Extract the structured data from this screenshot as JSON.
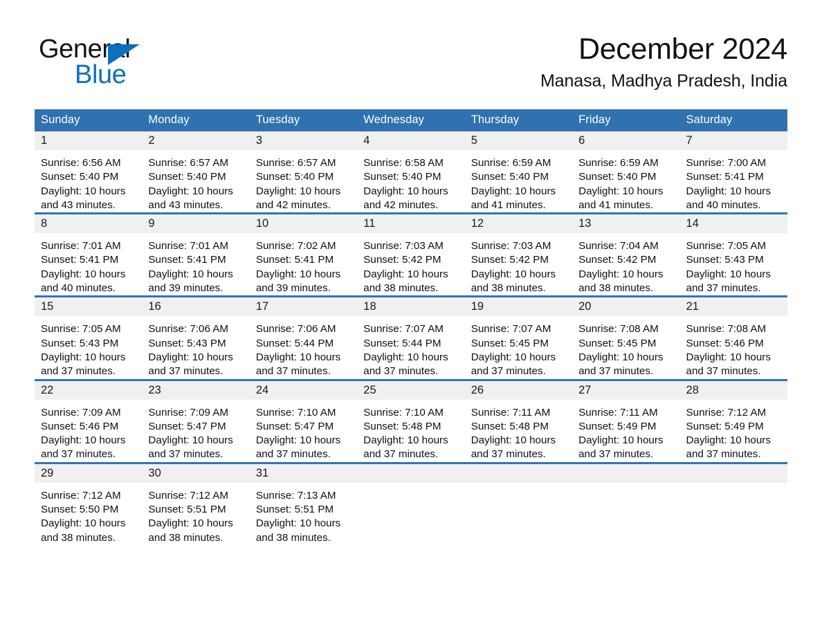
{
  "brand": {
    "name_part1": "General",
    "name_part2": "Blue",
    "triangle_icon": "triangle-icon",
    "accent_color": "#0E6FBC"
  },
  "header": {
    "title": "December 2024",
    "location": "Manasa, Madhya Pradesh, India"
  },
  "theme": {
    "header_blue": "#3071B0",
    "row_divider_blue": "#2E75B6",
    "daynum_band": "#F0F0F0"
  },
  "calendar": {
    "weekday_headers": [
      "Sunday",
      "Monday",
      "Tuesday",
      "Wednesday",
      "Thursday",
      "Friday",
      "Saturday"
    ],
    "weeks": [
      [
        {
          "day": "1",
          "sunrise": "Sunrise: 6:56 AM",
          "sunset": "Sunset: 5:40 PM",
          "daylight": "Daylight: 10 hours and 43 minutes."
        },
        {
          "day": "2",
          "sunrise": "Sunrise: 6:57 AM",
          "sunset": "Sunset: 5:40 PM",
          "daylight": "Daylight: 10 hours and 43 minutes."
        },
        {
          "day": "3",
          "sunrise": "Sunrise: 6:57 AM",
          "sunset": "Sunset: 5:40 PM",
          "daylight": "Daylight: 10 hours and 42 minutes."
        },
        {
          "day": "4",
          "sunrise": "Sunrise: 6:58 AM",
          "sunset": "Sunset: 5:40 PM",
          "daylight": "Daylight: 10 hours and 42 minutes."
        },
        {
          "day": "5",
          "sunrise": "Sunrise: 6:59 AM",
          "sunset": "Sunset: 5:40 PM",
          "daylight": "Daylight: 10 hours and 41 minutes."
        },
        {
          "day": "6",
          "sunrise": "Sunrise: 6:59 AM",
          "sunset": "Sunset: 5:40 PM",
          "daylight": "Daylight: 10 hours and 41 minutes."
        },
        {
          "day": "7",
          "sunrise": "Sunrise: 7:00 AM",
          "sunset": "Sunset: 5:41 PM",
          "daylight": "Daylight: 10 hours and 40 minutes."
        }
      ],
      [
        {
          "day": "8",
          "sunrise": "Sunrise: 7:01 AM",
          "sunset": "Sunset: 5:41 PM",
          "daylight": "Daylight: 10 hours and 40 minutes."
        },
        {
          "day": "9",
          "sunrise": "Sunrise: 7:01 AM",
          "sunset": "Sunset: 5:41 PM",
          "daylight": "Daylight: 10 hours and 39 minutes."
        },
        {
          "day": "10",
          "sunrise": "Sunrise: 7:02 AM",
          "sunset": "Sunset: 5:41 PM",
          "daylight": "Daylight: 10 hours and 39 minutes."
        },
        {
          "day": "11",
          "sunrise": "Sunrise: 7:03 AM",
          "sunset": "Sunset: 5:42 PM",
          "daylight": "Daylight: 10 hours and 38 minutes."
        },
        {
          "day": "12",
          "sunrise": "Sunrise: 7:03 AM",
          "sunset": "Sunset: 5:42 PM",
          "daylight": "Daylight: 10 hours and 38 minutes."
        },
        {
          "day": "13",
          "sunrise": "Sunrise: 7:04 AM",
          "sunset": "Sunset: 5:42 PM",
          "daylight": "Daylight: 10 hours and 38 minutes."
        },
        {
          "day": "14",
          "sunrise": "Sunrise: 7:05 AM",
          "sunset": "Sunset: 5:43 PM",
          "daylight": "Daylight: 10 hours and 37 minutes."
        }
      ],
      [
        {
          "day": "15",
          "sunrise": "Sunrise: 7:05 AM",
          "sunset": "Sunset: 5:43 PM",
          "daylight": "Daylight: 10 hours and 37 minutes."
        },
        {
          "day": "16",
          "sunrise": "Sunrise: 7:06 AM",
          "sunset": "Sunset: 5:43 PM",
          "daylight": "Daylight: 10 hours and 37 minutes."
        },
        {
          "day": "17",
          "sunrise": "Sunrise: 7:06 AM",
          "sunset": "Sunset: 5:44 PM",
          "daylight": "Daylight: 10 hours and 37 minutes."
        },
        {
          "day": "18",
          "sunrise": "Sunrise: 7:07 AM",
          "sunset": "Sunset: 5:44 PM",
          "daylight": "Daylight: 10 hours and 37 minutes."
        },
        {
          "day": "19",
          "sunrise": "Sunrise: 7:07 AM",
          "sunset": "Sunset: 5:45 PM",
          "daylight": "Daylight: 10 hours and 37 minutes."
        },
        {
          "day": "20",
          "sunrise": "Sunrise: 7:08 AM",
          "sunset": "Sunset: 5:45 PM",
          "daylight": "Daylight: 10 hours and 37 minutes."
        },
        {
          "day": "21",
          "sunrise": "Sunrise: 7:08 AM",
          "sunset": "Sunset: 5:46 PM",
          "daylight": "Daylight: 10 hours and 37 minutes."
        }
      ],
      [
        {
          "day": "22",
          "sunrise": "Sunrise: 7:09 AM",
          "sunset": "Sunset: 5:46 PM",
          "daylight": "Daylight: 10 hours and 37 minutes."
        },
        {
          "day": "23",
          "sunrise": "Sunrise: 7:09 AM",
          "sunset": "Sunset: 5:47 PM",
          "daylight": "Daylight: 10 hours and 37 minutes."
        },
        {
          "day": "24",
          "sunrise": "Sunrise: 7:10 AM",
          "sunset": "Sunset: 5:47 PM",
          "daylight": "Daylight: 10 hours and 37 minutes."
        },
        {
          "day": "25",
          "sunrise": "Sunrise: 7:10 AM",
          "sunset": "Sunset: 5:48 PM",
          "daylight": "Daylight: 10 hours and 37 minutes."
        },
        {
          "day": "26",
          "sunrise": "Sunrise: 7:11 AM",
          "sunset": "Sunset: 5:48 PM",
          "daylight": "Daylight: 10 hours and 37 minutes."
        },
        {
          "day": "27",
          "sunrise": "Sunrise: 7:11 AM",
          "sunset": "Sunset: 5:49 PM",
          "daylight": "Daylight: 10 hours and 37 minutes."
        },
        {
          "day": "28",
          "sunrise": "Sunrise: 7:12 AM",
          "sunset": "Sunset: 5:49 PM",
          "daylight": "Daylight: 10 hours and 37 minutes."
        }
      ],
      [
        {
          "day": "29",
          "sunrise": "Sunrise: 7:12 AM",
          "sunset": "Sunset: 5:50 PM",
          "daylight": "Daylight: 10 hours and 38 minutes."
        },
        {
          "day": "30",
          "sunrise": "Sunrise: 7:12 AM",
          "sunset": "Sunset: 5:51 PM",
          "daylight": "Daylight: 10 hours and 38 minutes."
        },
        {
          "day": "31",
          "sunrise": "Sunrise: 7:13 AM",
          "sunset": "Sunset: 5:51 PM",
          "daylight": "Daylight: 10 hours and 38 minutes."
        },
        {
          "day": "",
          "sunrise": "",
          "sunset": "",
          "daylight": ""
        },
        {
          "day": "",
          "sunrise": "",
          "sunset": "",
          "daylight": ""
        },
        {
          "day": "",
          "sunrise": "",
          "sunset": "",
          "daylight": ""
        },
        {
          "day": "",
          "sunrise": "",
          "sunset": "",
          "daylight": ""
        }
      ]
    ]
  }
}
